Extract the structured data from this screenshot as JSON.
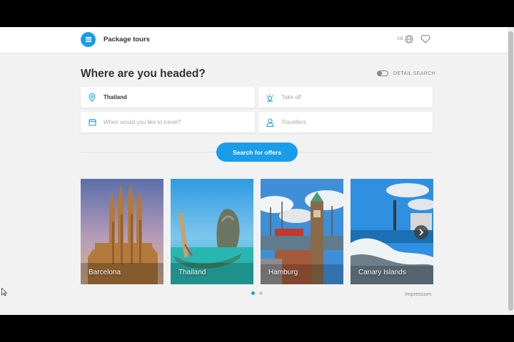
{
  "header": {
    "brand": "Package tours",
    "language_code": "GB",
    "icons": [
      "menu-icon",
      "globe-icon",
      "heart-icon"
    ]
  },
  "search": {
    "title": "Where are you headed?",
    "detail_search_label": "DETAIL SEARCH",
    "destination_value": "Thailand",
    "takeoff_placeholder": "Take off",
    "date_placeholder": "When would you like to travel?",
    "travellers_placeholder": "Travellers",
    "submit_label": "Search for offers"
  },
  "destinations": [
    {
      "label": "Barcelona"
    },
    {
      "label": "Thailand"
    },
    {
      "label": "Hamburg"
    },
    {
      "label": "Canary Islands"
    }
  ],
  "pagination": {
    "pages": 2,
    "active": 1
  },
  "footer": {
    "impressum": "Impressum"
  },
  "colors": {
    "accent": "#1a9de9",
    "background": "#f2f2f2"
  }
}
